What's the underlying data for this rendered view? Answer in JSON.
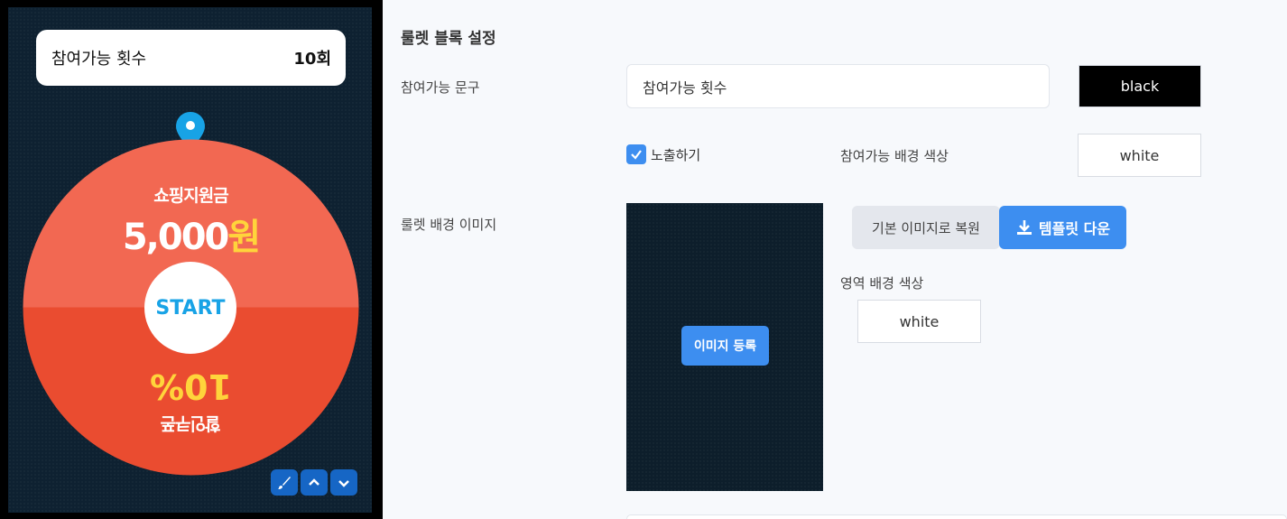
{
  "preview": {
    "count_label": "참여가능 횟수",
    "count_value": "10회",
    "wheel": {
      "top_title": "쇼핑지원금",
      "top_amount": "5,000",
      "top_amount_unit": "원",
      "start_label": "START",
      "bottom_title": "10%",
      "bottom_sub": "할인쿠폰",
      "top_color": "#f26852",
      "bottom_color": "#ea4c30"
    },
    "mini_buttons": [
      "brush-icon",
      "chevron-up-icon",
      "chevron-down-icon"
    ]
  },
  "settings": {
    "section_title": "룰렛 블록 설정",
    "phrase_label": "참여가능 문구",
    "phrase_value": "참여가능 횟수",
    "phrase_color": "black",
    "show_label": "노출하기",
    "show_checked": true,
    "bg_color_label": "참여가능 배경 색상",
    "bg_color_value": "white",
    "bg_image_label": "룰렛 배경 이미지",
    "register_label": "이미지 등록",
    "restore_label": "기본 이미지로 복원",
    "download_label": "템플릿 다운",
    "area_bg_label": "영역 배경 색상",
    "area_bg_value": "white"
  }
}
